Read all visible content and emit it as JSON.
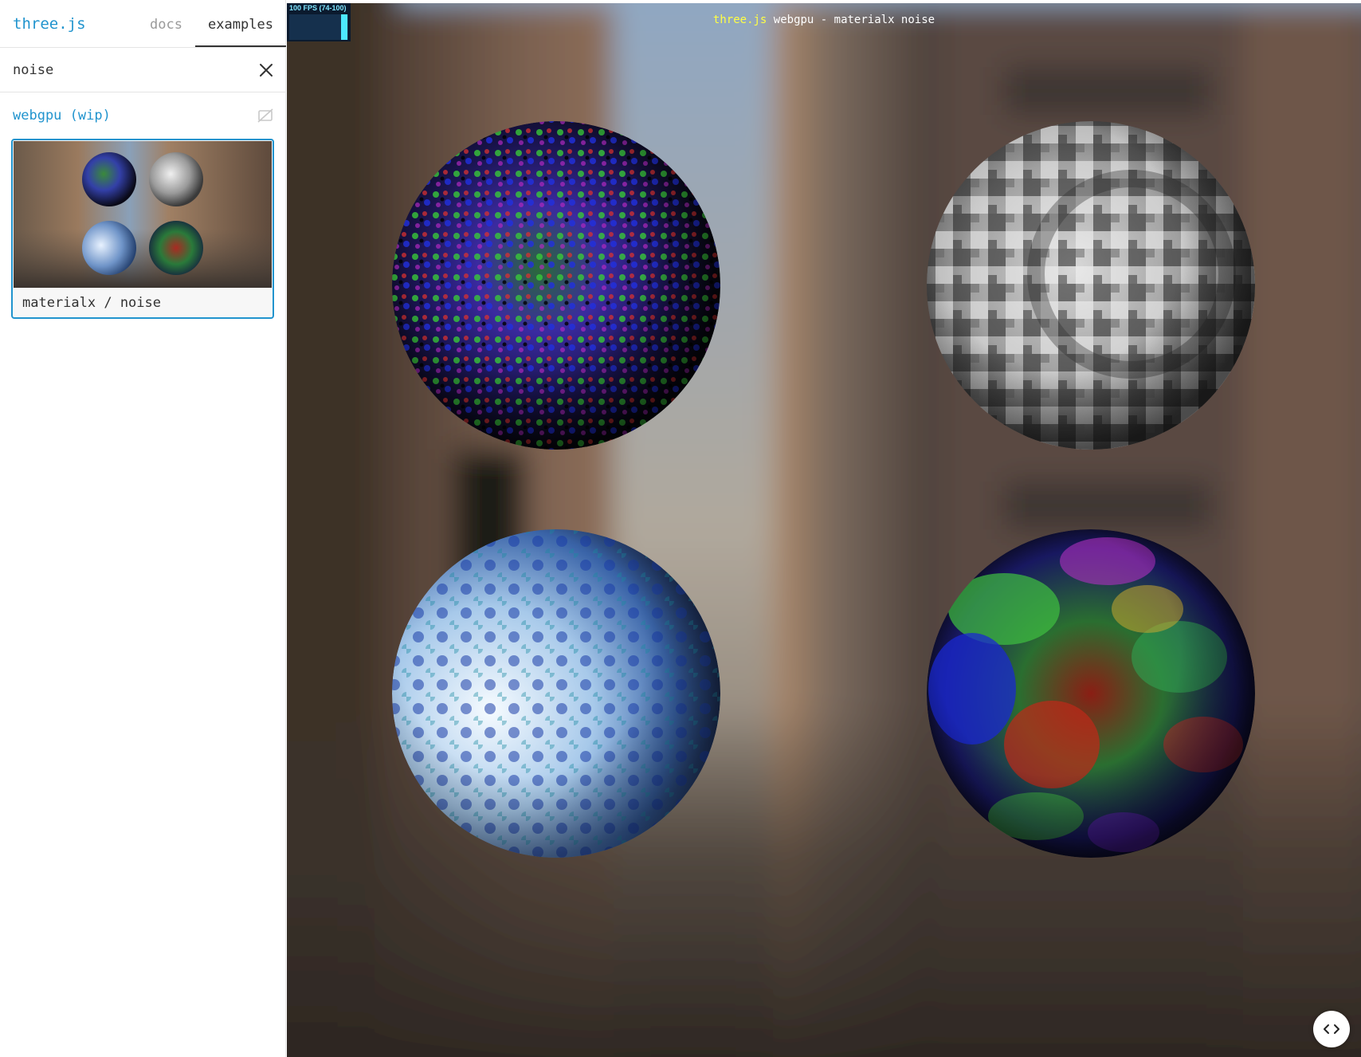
{
  "sidebar": {
    "brand": "three.js",
    "tabs": [
      {
        "label": "docs",
        "active": false
      },
      {
        "label": "examples",
        "active": true
      }
    ],
    "search": {
      "value": "noise",
      "placeholder": "Search"
    },
    "category": {
      "title": "webgpu (wip)"
    },
    "examples": [
      {
        "label": "materialx / noise",
        "selected": true
      }
    ]
  },
  "viewport": {
    "info": {
      "link_text": "three.js",
      "text": " webgpu - materialx noise"
    },
    "stats": {
      "text": "100 FPS (74-100)"
    },
    "code_button_icon": "code-icon"
  },
  "icons": {
    "clear": "close-icon",
    "category_toggle": "eye-off-icon"
  },
  "colors": {
    "accent": "#2194ce",
    "info_link": "#ffff44",
    "stats_text": "#7fe6ff"
  }
}
